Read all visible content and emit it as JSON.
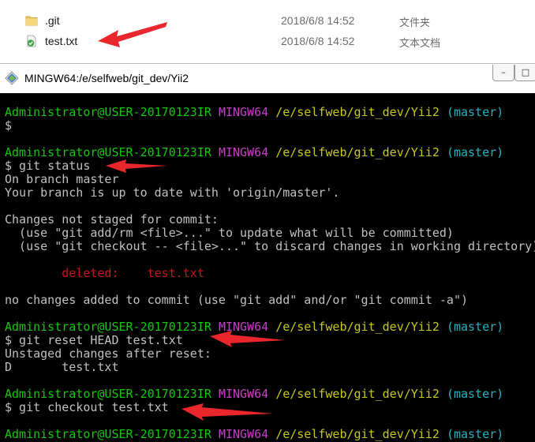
{
  "explorer": {
    "files": [
      {
        "name": ".git",
        "date": "2018/6/8 14:52",
        "type": "文件夹",
        "icon": "folder-icon"
      },
      {
        "name": "test.txt",
        "date": "2018/6/8 14:52",
        "type": "文本文档",
        "icon": "git-file-icon"
      }
    ]
  },
  "window": {
    "title": "MINGW64:/e/selfweb/git_dev/Yii2",
    "minimize": "–",
    "maximize": "□"
  },
  "prompt": {
    "user": "Administrator@USER-20170123IR",
    "system": "MINGW64",
    "path": "/e/selfweb/git_dev/Yii2",
    "branch": "(master)"
  },
  "terminal": {
    "blocks": [
      {
        "lines": [
          "$"
        ]
      },
      {
        "lines": [
          "$ git status",
          "On branch master",
          "Your branch is up to date with 'origin/master'.",
          "",
          "Changes not staged for commit:",
          "  (use \"git add/rm <file>...\" to update what will be committed)",
          "  (use \"git checkout -- <file>...\" to discard changes in working directory)",
          "",
          "",
          "",
          "no changes added to commit (use \"git add\" and/or \"git commit -a\")"
        ],
        "deleted_label": "deleted:",
        "deleted_file": "test.txt"
      },
      {
        "lines": [
          "$ git reset HEAD test.txt",
          "Unstaged changes after reset:",
          "D       test.txt"
        ]
      },
      {
        "lines": [
          "$ git checkout test.txt"
        ]
      }
    ]
  },
  "colors": {
    "prompt_user": "#16c60c",
    "prompt_system": "#c53fc5",
    "prompt_path": "#c8c81a",
    "prompt_branch": "#1fb4c4",
    "deleted": "#c5141c",
    "annotation_arrow": "#e8262b",
    "terminal_bg": "#000000"
  }
}
